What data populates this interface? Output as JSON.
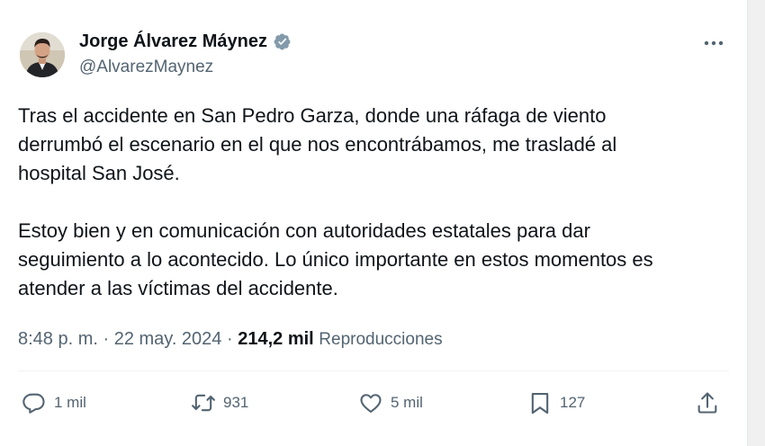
{
  "tweet": {
    "author": {
      "name": "Jorge Álvarez Máynez",
      "handle": "@AlvarezMaynez",
      "verified": true,
      "verified_color": "#829aab"
    },
    "text_lines": [
      "Tras el accidente en San Pedro Garza, donde una ráfaga de viento",
      "derrumbó el escenario en el que nos encontrábamos, me trasladé al",
      "hospital San José.",
      "Estoy bien y en comunicación con autoridades estatales para dar",
      "seguimiento a lo acontecido. Lo único importante en estos momentos es",
      "atender a las víctimas del accidente."
    ],
    "meta": {
      "time": "8:48 p. m.",
      "separator": " · ",
      "date": "22 may. 2024",
      "views": "214,2 mil",
      "views_label": "Reproducciones"
    },
    "actions": {
      "reply": {
        "icon": "reply-icon",
        "count": "1 mil"
      },
      "retweet": {
        "icon": "retweet-icon",
        "count": "931"
      },
      "like": {
        "icon": "heart-icon",
        "count": "5 mil"
      },
      "bookmark": {
        "icon": "bookmark-icon",
        "count": "127"
      },
      "share": {
        "icon": "share-icon"
      }
    },
    "more_icon": "more-icon"
  }
}
